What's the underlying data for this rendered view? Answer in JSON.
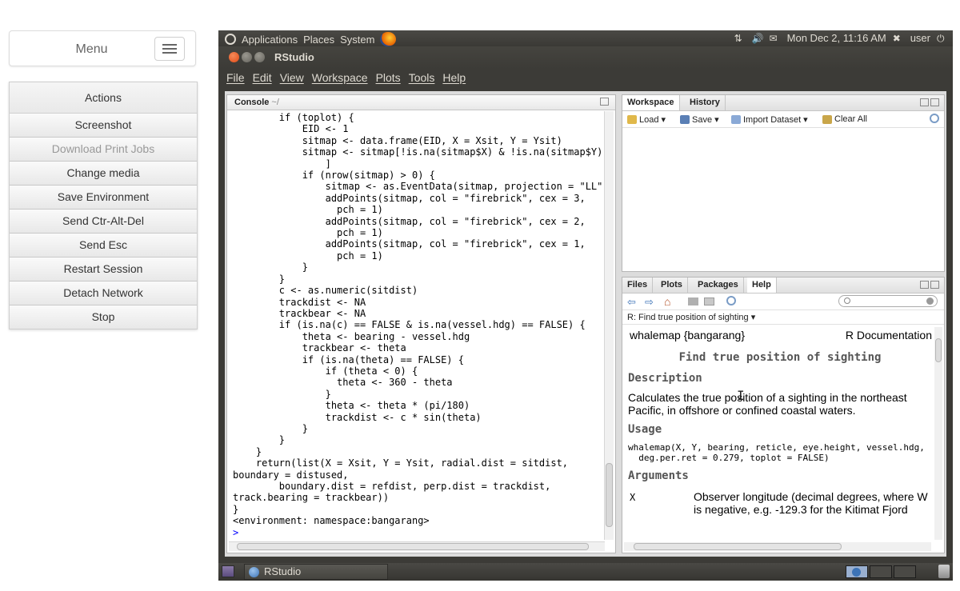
{
  "sidebar": {
    "menu_label": "Menu",
    "actions_title": "Actions",
    "actions": [
      {
        "label": "Screenshot",
        "enabled": true
      },
      {
        "label": "Download Print Jobs",
        "enabled": false
      },
      {
        "label": "Change media",
        "enabled": true
      },
      {
        "label": "Save Environment",
        "enabled": true
      },
      {
        "label": "Send Ctr-Alt-Del",
        "enabled": true
      },
      {
        "label": "Send Esc",
        "enabled": true
      },
      {
        "label": "Restart Session",
        "enabled": true
      },
      {
        "label": "Detach Network",
        "enabled": true
      },
      {
        "label": "Stop",
        "enabled": true
      }
    ]
  },
  "top_panel": {
    "menus": [
      "Applications",
      "Places",
      "System"
    ],
    "datetime": "Mon Dec 2, 11:16 AM",
    "user": "user"
  },
  "window": {
    "title": "RStudio",
    "menus": [
      "File",
      "Edit",
      "View",
      "Workspace",
      "Plots",
      "Tools",
      "Help"
    ]
  },
  "console": {
    "tab_label": "Console",
    "path": "~/",
    "code": "        if (toplot) {\n            EID <- 1\n            sitmap <- data.frame(EID, X = Xsit, Y = Ysit)\n            sitmap <- sitmap[!is.na(sitmap$X) & !is.na(sitmap$Y),\n                ]\n            if (nrow(sitmap) > 0) {\n                sitmap <- as.EventData(sitmap, projection = \"LL\")\n                addPoints(sitmap, col = \"firebrick\", cex = 3,\n                  pch = 1)\n                addPoints(sitmap, col = \"firebrick\", cex = 2,\n                  pch = 1)\n                addPoints(sitmap, col = \"firebrick\", cex = 1,\n                  pch = 1)\n            }\n        }\n        c <- as.numeric(sitdist)\n        trackdist <- NA\n        trackbear <- NA\n        if (is.na(c) == FALSE & is.na(vessel.hdg) == FALSE) {\n            theta <- bearing - vessel.hdg\n            trackbear <- theta\n            if (is.na(theta) == FALSE) {\n                if (theta < 0) {\n                  theta <- 360 - theta\n                }\n                theta <- theta * (pi/180)\n                trackdist <- c * sin(theta)\n            }\n        }\n    }\n    return(list(X = Xsit, Y = Ysit, radial.dist = sitdist,\nboundary = distused,\n        boundary.dist = refdist, perp.dist = trackdist,\ntrack.bearing = trackbear))\n}\n<environment: namespace:bangarang>",
    "prompt": ">"
  },
  "workspace": {
    "tabs": [
      "Workspace",
      "History"
    ],
    "toolbar": [
      "Load",
      "Save",
      "Import Dataset",
      "Clear All"
    ]
  },
  "help": {
    "tabs": [
      "Files",
      "Plots",
      "Packages",
      "Help"
    ],
    "topic": "R: Find true position of sighting",
    "doc_name": "whalemap {bangarang}",
    "doc_right": "R Documentation",
    "doc_title": "Find true position of sighting",
    "description_heading": "Description",
    "description": "Calculates the true position of a sighting in the northeast Pacific, in offshore or confined coastal waters.",
    "usage_heading": "Usage",
    "usage": "whalemap(X, Y, bearing, reticle, eye.height, vessel.hdg,\n  deg.per.ret = 0.279, toplot = FALSE)",
    "arguments_heading": "Arguments",
    "arg_name": "X",
    "arg_desc": "Observer longitude (decimal degrees, where W is negative, e.g. -129.3 for the Kitimat Fjord"
  },
  "taskbar": {
    "task": "RStudio"
  }
}
